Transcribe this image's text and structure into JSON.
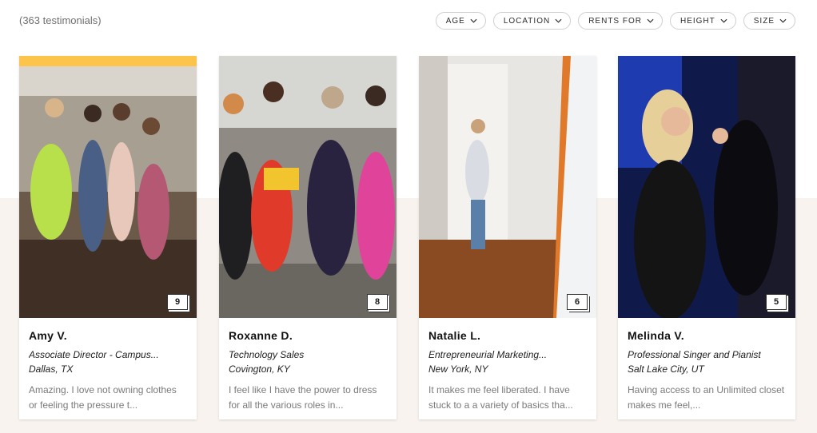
{
  "header": {
    "count_text": "(363 testimonials)"
  },
  "filters": [
    {
      "label": "AGE"
    },
    {
      "label": "LOCATION"
    },
    {
      "label": "RENTS FOR"
    },
    {
      "label": "HEIGHT"
    },
    {
      "label": "SIZE"
    }
  ],
  "cards": [
    {
      "name": "Amy V.",
      "title": "Associate Director - Campus...",
      "location": "Dallas, TX",
      "quote": "Amazing. I love not owning clothes or feeling the pressure t...",
      "photo_count": "9"
    },
    {
      "name": "Roxanne D.",
      "title": "Technology Sales",
      "location": "Covington, KY",
      "quote": "I feel like I have the power to dress for all the various roles in...",
      "photo_count": "8"
    },
    {
      "name": "Natalie L.",
      "title": "Entrepreneurial Marketing...",
      "location": "New York, NY",
      "quote": "It makes me feel liberated. I have stuck to a a variety of basics tha...",
      "photo_count": "6"
    },
    {
      "name": "Melinda V.",
      "title": "Professional Singer and Pianist",
      "location": "Salt Lake City, UT",
      "quote": "Having access to an Unlimited closet makes me feel,...",
      "photo_count": "5"
    }
  ],
  "colors": {
    "accent_strip": "#fcc44a",
    "band_background": "#f8f3ef"
  }
}
